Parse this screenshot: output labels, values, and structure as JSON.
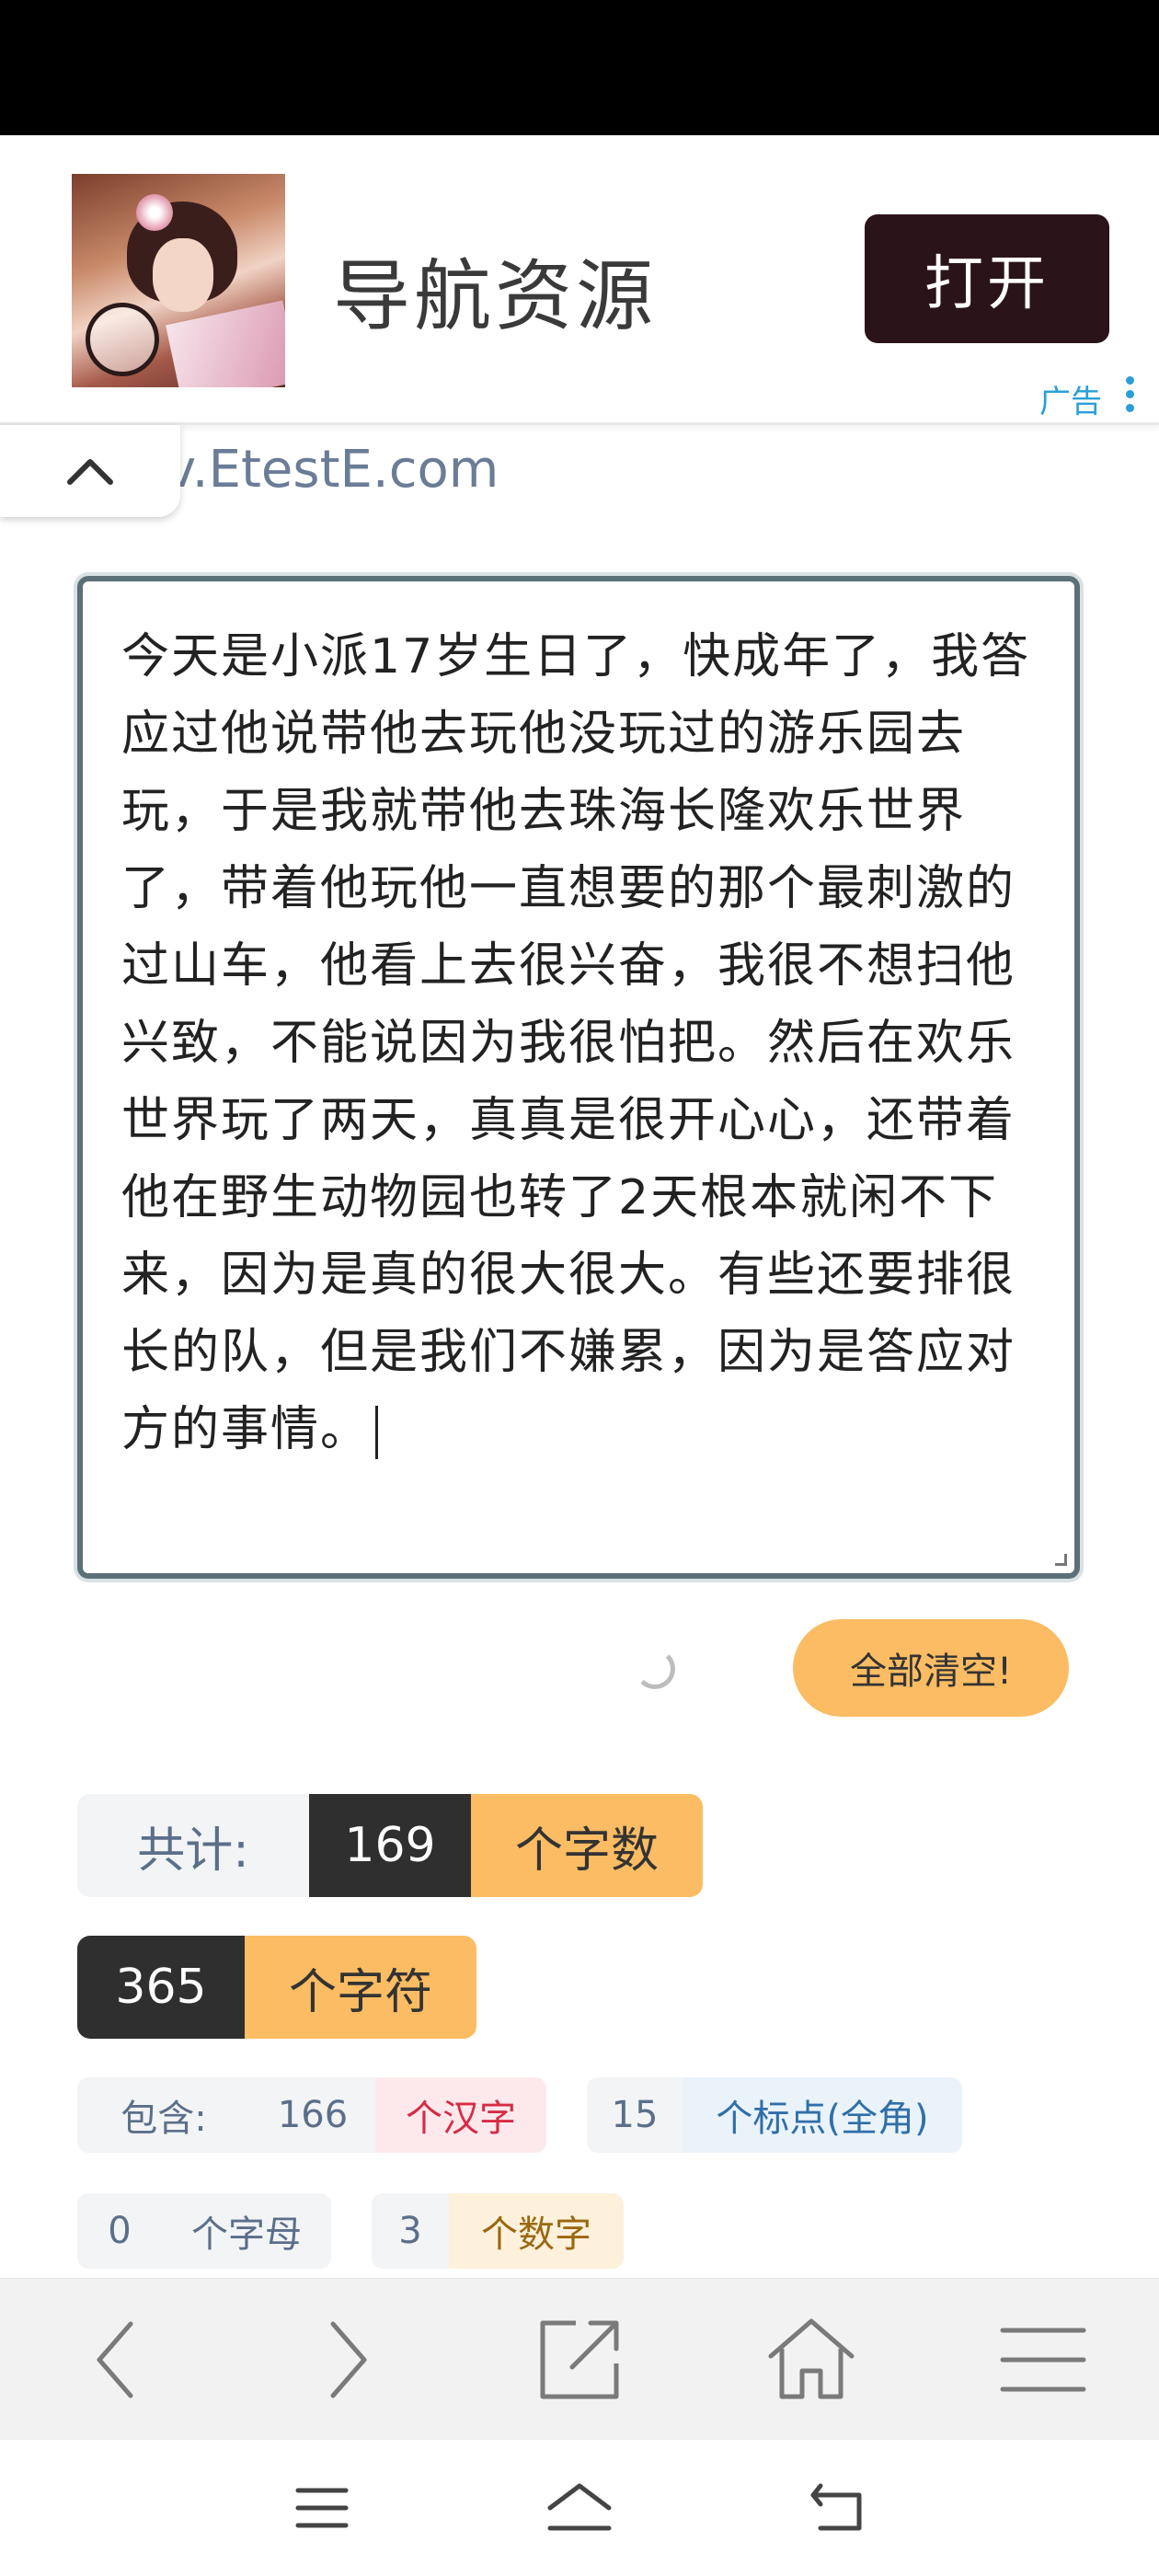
{
  "ad": {
    "title": "导航资源",
    "open_label": "打开",
    "label": "广告"
  },
  "site": {
    "url_fragment": "v.EtestE.com"
  },
  "editor": {
    "text": "今天是小派17岁生日了，快成年了，我答应过他说带他去玩他没玩过的游乐园去玩，于是我就带他去珠海长隆欢乐世界了，带着他玩他一直想要的那个最刺激的过山车，他看上去很兴奋，我很不想扫他兴致，不能说因为我很怕把。然后在欢乐世界玩了两天，真真是很开心心，还带着他在野生动物园也转了2天根本就闲不下来，因为是真的很大很大。有些还要排很长的队，但是我们不嫌累，因为是答应对方的事情。"
  },
  "actions": {
    "clear_all_label": "全部清空!"
  },
  "stats": {
    "total_label": "共计:",
    "word_count": "169",
    "word_unit": "个字数",
    "char_count": "365",
    "char_unit": "个字符",
    "include_label": "包含:",
    "hanzi_count": "166",
    "hanzi_unit": "个汉字",
    "punct_count": "15",
    "punct_unit": "个标点(全角)",
    "letter_count": "0",
    "letter_unit": "个字母",
    "digit_count": "3",
    "digit_unit": "个数字"
  },
  "icons": {
    "collapse": "chevron-up-icon",
    "back": "chevron-left-icon",
    "forward": "chevron-right-icon",
    "share": "share-icon",
    "home": "home-icon",
    "menu": "menu-icon"
  },
  "colors": {
    "accent_orange": "#fcbc63",
    "dark": "#2f2f2f",
    "ad_button": "#2b1419",
    "textarea_border": "#5b7177"
  }
}
